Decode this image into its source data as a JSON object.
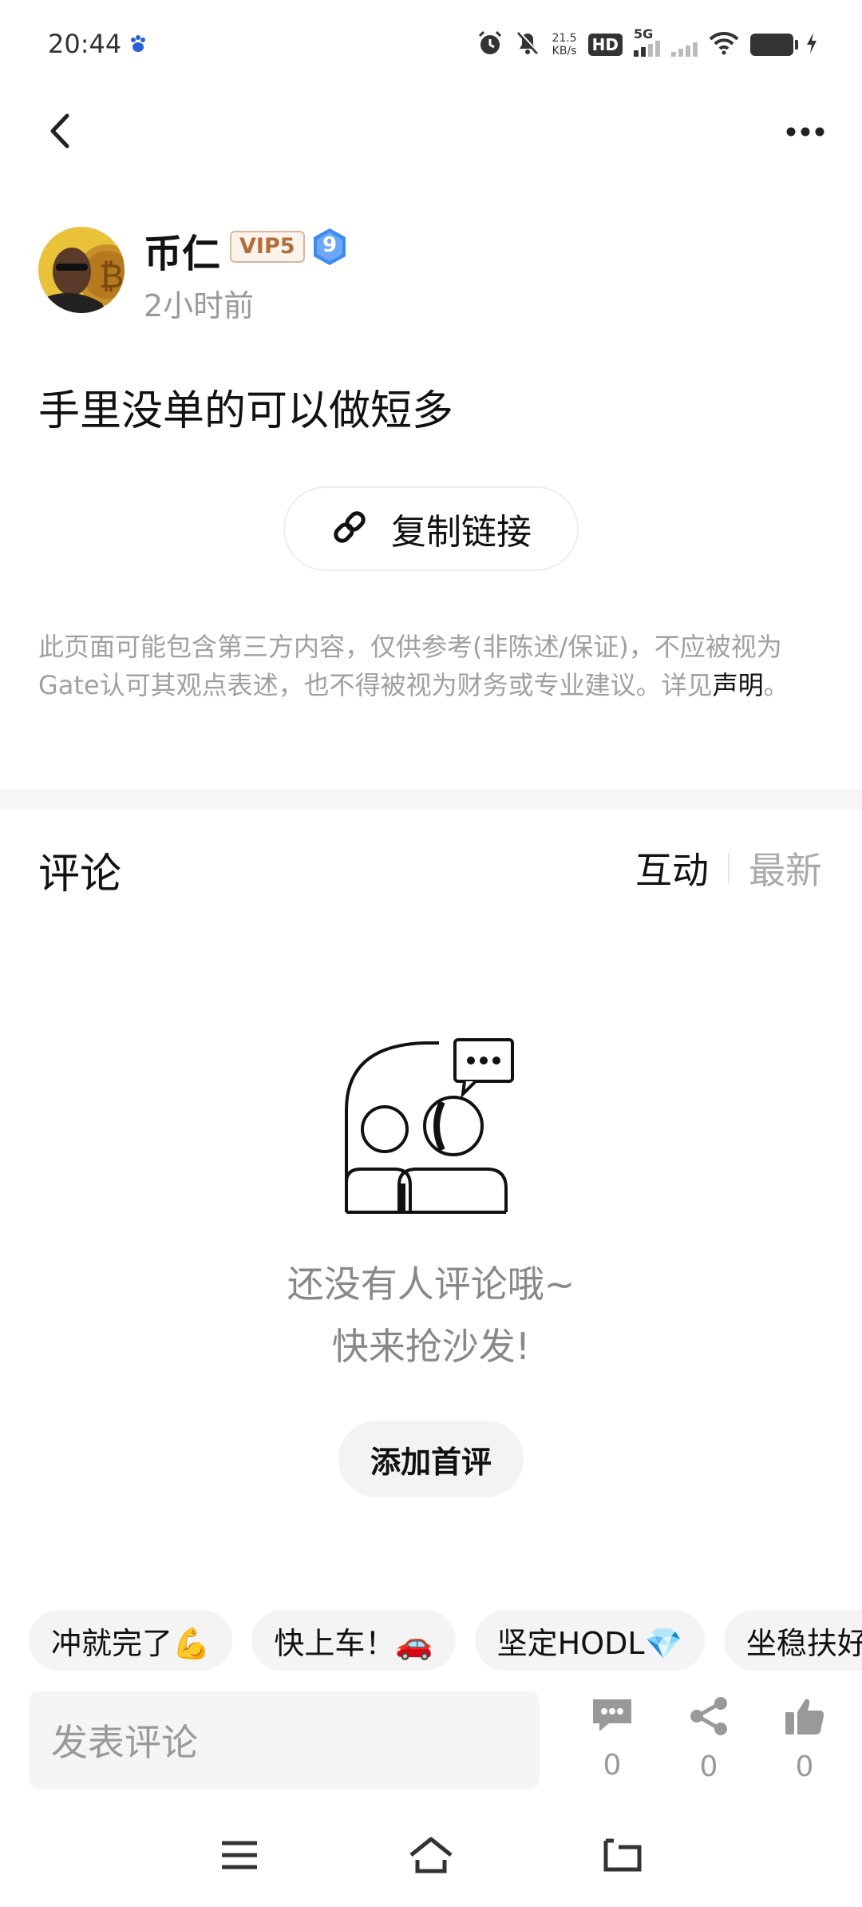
{
  "status_bar": {
    "time": "20:44",
    "net_speed_value": "21.5",
    "net_speed_unit": "KB/s",
    "hd_label": "HD",
    "hd_sub": "1",
    "network_label": "5G",
    "icons": [
      "baidu-paw-icon",
      "alarm-icon",
      "mute-icon",
      "wifi-icon",
      "battery-icon",
      "charging-icon"
    ]
  },
  "header": {
    "back_icon": "chevron-left-icon",
    "more_icon": "more-dots-icon"
  },
  "author": {
    "name": "币仁",
    "vip": "VIP5",
    "level": "9",
    "time": "2小时前"
  },
  "post": {
    "text": "手里没单的可以做短多"
  },
  "copy_link": {
    "label": "复制链接",
    "icon": "link-icon"
  },
  "disclaimer": {
    "text": "此页面可能包含第三方内容，仅供参考(非陈述/保证)，不应被视为Gate认可其观点表述，也不得被视为财务或专业建议。详见",
    "link_text": "声明",
    "end": "。"
  },
  "comments": {
    "title": "评论",
    "tabs": [
      {
        "label": "互动",
        "active": true
      },
      {
        "label": "最新",
        "active": false
      }
    ],
    "empty_line1": "还没有人评论哦~",
    "empty_line2": "快来抢沙发!",
    "add_first": "添加首评"
  },
  "quick_replies": [
    "冲就完了💪",
    "快上车！🚗",
    "坚定HODL💎",
    "坐稳扶好"
  ],
  "bottom_bar": {
    "input_placeholder": "发表评论",
    "actions": [
      {
        "icon": "comment-icon",
        "count": "0"
      },
      {
        "icon": "share-icon",
        "count": "0"
      },
      {
        "icon": "like-icon",
        "count": "0"
      }
    ]
  },
  "nav_bar": {
    "icons": [
      "menu-icon",
      "home-icon",
      "back-nav-icon"
    ]
  },
  "colors": {
    "text_primary": "#111111",
    "text_secondary": "#999999",
    "vip_badge_text": "#b46c3a",
    "level_badge": "#3d8bf2",
    "chip_bg": "#f4f4f4"
  }
}
